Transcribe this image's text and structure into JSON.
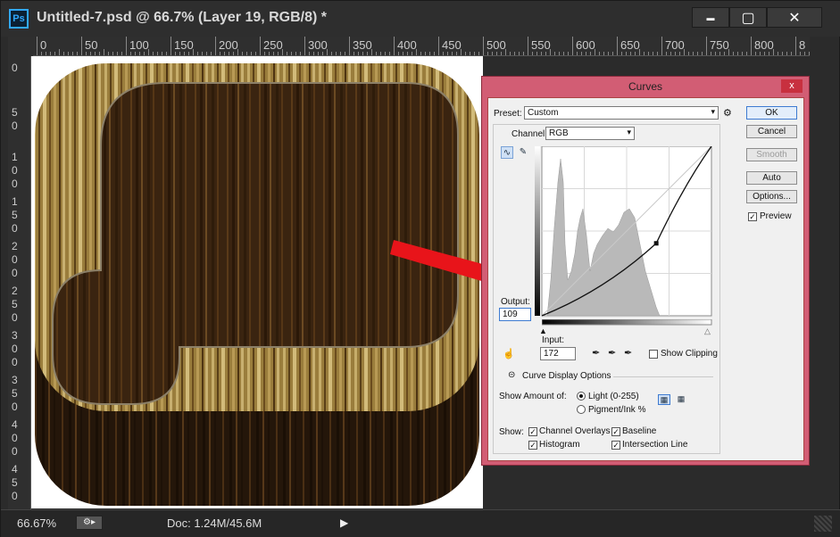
{
  "window": {
    "app_logo": "Ps",
    "title": "Untitled-7.psd @ 66.7% (Layer 19, RGB/8) *",
    "minimize_glyph": "▬",
    "maximize_glyph": "▢",
    "close_glyph": "✕"
  },
  "ruler": {
    "h_labels": [
      "0",
      "50",
      "100",
      "150",
      "200",
      "250",
      "300",
      "350",
      "400",
      "450",
      "500",
      "550",
      "600",
      "650",
      "700",
      "750",
      "800",
      "8"
    ],
    "v_labels": [
      "0",
      "5\n0",
      "1\n0\n0",
      "1\n5\n0",
      "2\n0\n0",
      "2\n5\n0",
      "3\n0\n0",
      "3\n5\n0",
      "4\n0\n0",
      "4\n5\n0"
    ]
  },
  "status": {
    "zoom": "66.67%",
    "doc": "Doc: 1.24M/45.6M"
  },
  "curves": {
    "title": "Curves",
    "close_glyph": "x",
    "preset_label": "Preset:",
    "preset_value": "Custom",
    "channel_label": "Channel:",
    "channel_value": "RGB",
    "output_label": "Output:",
    "output_value": "109",
    "input_label": "Input:",
    "input_value": "172",
    "show_clipping": "Show Clipping",
    "curve_display_options": "Curve Display Options",
    "show_amount_label": "Show Amount of:",
    "light": "Light  (0-255)",
    "pigment": "Pigment/Ink %",
    "show_label": "Show:",
    "channel_overlays": "Channel Overlays",
    "baseline": "Baseline",
    "histogram": "Histogram",
    "intersection_line": "Intersection Line",
    "buttons": {
      "ok": "OK",
      "cancel": "Cancel",
      "smooth": "Smooth",
      "auto": "Auto",
      "options": "Options..."
    },
    "preview": "Preview",
    "check_glyph": "✓",
    "dropdown_glyph": "▾",
    "gear_glyph": "⚙",
    "point_input": 172,
    "point_output": 109
  },
  "colors": {
    "dialog_frame": "#d25d74",
    "arrow": "#e8141a",
    "wood_light": "#b49a52",
    "wood_dark": "#3a2410"
  }
}
